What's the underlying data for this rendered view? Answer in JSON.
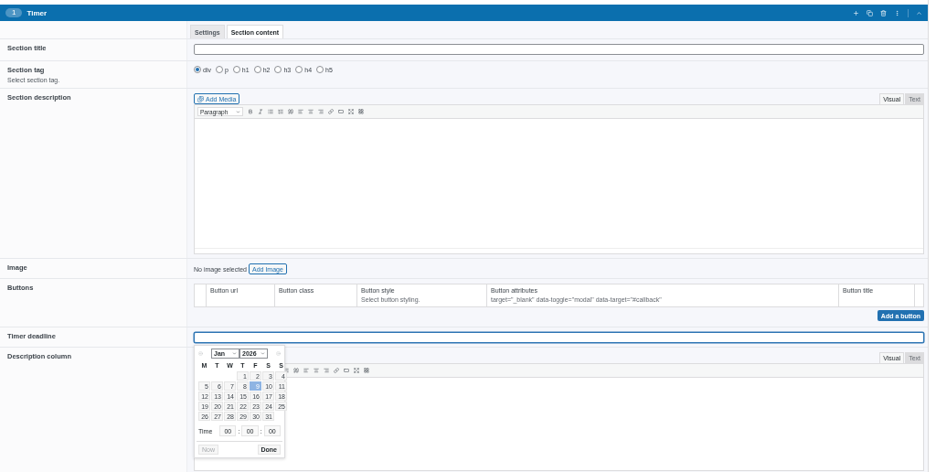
{
  "header": {
    "title": "Timer",
    "badge": "1"
  },
  "tabs": [
    {
      "label": "Settings",
      "selected": false
    },
    {
      "label": "Section content",
      "selected": true
    }
  ],
  "fields": [
    {
      "kind": "text",
      "label": "Section title",
      "focused": false
    },
    {
      "kind": "radio",
      "label": "Section tag",
      "description": "Select section tag.",
      "options": [
        {
          "label": "div",
          "selected": true
        },
        {
          "label": "p",
          "selected": false
        },
        {
          "label": "h1",
          "selected": false
        },
        {
          "label": "h2",
          "selected": false
        },
        {
          "label": "h3",
          "selected": false
        },
        {
          "label": "h4",
          "selected": false
        },
        {
          "label": "h5",
          "selected": false
        }
      ]
    },
    {
      "kind": "editor",
      "label": "Section description",
      "media_button": "Add Media",
      "format": "Paragraph",
      "modes": [
        {
          "label": "Visual",
          "selected": true
        },
        {
          "label": "Text",
          "selected": false
        }
      ]
    },
    {
      "kind": "image",
      "label": "Image",
      "status": "No image selected",
      "button": "Add Image"
    },
    {
      "kind": "repeater",
      "label": "Buttons",
      "columns": [
        {
          "title": "Button url"
        },
        {
          "title": "Button class"
        },
        {
          "title": "Button style",
          "description": "Select button styling."
        },
        {
          "title": "Button attributes",
          "description": "target=\"_blank\" data-toggle=\"modal\" data-target=\"#callback\""
        },
        {
          "title": "Button title"
        }
      ],
      "add_button": "Add a button"
    },
    {
      "kind": "date",
      "label": "Timer deadline",
      "focused": true,
      "picker": {
        "month": "Jan",
        "year": "2026",
        "weekdays": [
          "M",
          "T",
          "W",
          "T",
          "F",
          "S",
          "S"
        ],
        "weeks": [
          [
            {
              "kind": "blank"
            },
            {
              "kind": "blank"
            },
            {
              "kind": "blank"
            },
            {
              "kind": "day",
              "label": "1",
              "selected": false
            },
            {
              "kind": "day",
              "label": "2",
              "selected": false
            },
            {
              "kind": "day",
              "label": "3",
              "selected": false
            },
            {
              "kind": "day",
              "label": "4",
              "selected": false
            }
          ],
          [
            {
              "kind": "day",
              "label": "5",
              "selected": false
            },
            {
              "kind": "day",
              "label": "6",
              "selected": false
            },
            {
              "kind": "day",
              "label": "7",
              "selected": false
            },
            {
              "kind": "day",
              "label": "8",
              "selected": false
            },
            {
              "kind": "day",
              "label": "9",
              "selected": true
            },
            {
              "kind": "day",
              "label": "10",
              "selected": false
            },
            {
              "kind": "day",
              "label": "11",
              "selected": false
            }
          ],
          [
            {
              "kind": "day",
              "label": "12",
              "selected": false
            },
            {
              "kind": "day",
              "label": "13",
              "selected": false
            },
            {
              "kind": "day",
              "label": "14",
              "selected": false
            },
            {
              "kind": "day",
              "label": "15",
              "selected": false
            },
            {
              "kind": "day",
              "label": "16",
              "selected": false
            },
            {
              "kind": "day",
              "label": "17",
              "selected": false
            },
            {
              "kind": "day",
              "label": "18",
              "selected": false
            }
          ],
          [
            {
              "kind": "day",
              "label": "19",
              "selected": false
            },
            {
              "kind": "day",
              "label": "20",
              "selected": false
            },
            {
              "kind": "day",
              "label": "21",
              "selected": false
            },
            {
              "kind": "day",
              "label": "22",
              "selected": false
            },
            {
              "kind": "day",
              "label": "23",
              "selected": false
            },
            {
              "kind": "day",
              "label": "24",
              "selected": false
            },
            {
              "kind": "day",
              "label": "25",
              "selected": false
            }
          ],
          [
            {
              "kind": "day",
              "label": "26",
              "selected": false
            },
            {
              "kind": "day",
              "label": "27",
              "selected": false
            },
            {
              "kind": "day",
              "label": "28",
              "selected": false
            },
            {
              "kind": "day",
              "label": "29",
              "selected": false
            },
            {
              "kind": "day",
              "label": "30",
              "selected": false
            },
            {
              "kind": "day",
              "label": "31",
              "selected": false
            },
            {
              "kind": "blank"
            }
          ]
        ],
        "time_label": "Time",
        "hours": "00",
        "minutes": "00",
        "seconds": "00",
        "separator": ":",
        "now_button": {
          "label": "Now",
          "disabled": true
        },
        "done_button": "Done"
      }
    },
    {
      "kind": "editor",
      "label": "Description column",
      "modes": [
        {
          "label": "Visual",
          "selected": true
        },
        {
          "label": "Text",
          "selected": false
        }
      ]
    }
  ]
}
